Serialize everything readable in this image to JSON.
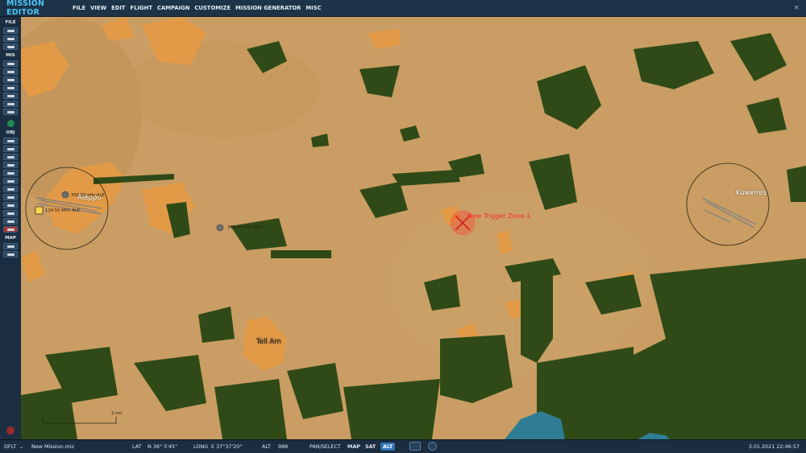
{
  "app": {
    "title": "MISSION EDITOR",
    "menu": [
      "FILE",
      "VIEW",
      "EDIT",
      "FLIGHT",
      "CAMPAIGN",
      "CUSTOMIZE",
      "MISSION GENERATOR",
      "MISC"
    ],
    "close_glyph": "×"
  },
  "sidebar": {
    "sections": {
      "file": "FILE",
      "mis": "MIS",
      "obj": "OBJ",
      "map": "MAP"
    }
  },
  "map": {
    "cities": [
      "Aleppo",
      "Kuweires",
      "Tell Arn"
    ],
    "trigger_zone": "New Trigger Zone-1",
    "beacons": [
      "395.00 kHz ALE",
      "114.50 MHz ALE",
      "365.00 kHz MER"
    ],
    "scale_label": "2 nm",
    "colors": {
      "desert": "#c99d63",
      "vegetation": "#2f4a17",
      "urban": "#e29a47",
      "water": "#2f7d94",
      "trigger": "#ff2b2b"
    }
  },
  "status": {
    "profile": "DFLT",
    "file": "New Mission.miz",
    "lat_label": "LAT",
    "lat_value": "N 36° 5'45\"",
    "long_label": "LONG",
    "long_value": "E 37°37'20\"",
    "alt_label": "ALT",
    "alt_value": "988",
    "mode": "PAN/SELECT",
    "map_modes": [
      "MAP",
      "SAT",
      "ALT"
    ],
    "active_map_mode": "ALT",
    "datetime": "3.01.2021 22:46:57"
  }
}
